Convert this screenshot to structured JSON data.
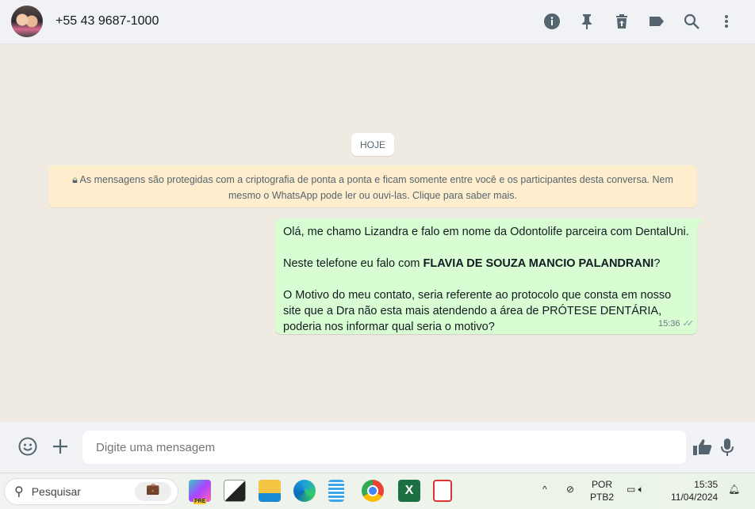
{
  "header": {
    "contact": "+55 43 9687-1000",
    "icons": [
      "info-icon",
      "pin-icon",
      "delete-icon",
      "label-icon",
      "search-icon",
      "menu-icon"
    ]
  },
  "chat": {
    "date_pill": "HOJE",
    "encryption_notice": "As mensagens são protegidas com a criptografia de ponta a ponta e ficam somente entre você e os participantes desta conversa. Nem mesmo o WhatsApp pode ler ou ouvi-las. Clique para saber mais.",
    "message": {
      "line1": "Olá, me chamo Lizandra e falo em nome da Odontolife parceira com DentalUni.",
      "line2_pre": "Neste telefone eu falo com ",
      "line2_bold": "FLAVIA DE SOUZA MANCIO PALANDRANI",
      "line2_post": "?",
      "line3": "O Motivo do meu contato, seria referente ao protocolo que consta em nosso site que a Dra não esta mais atendendo a área de PRÓTESE DENTÁRIA, poderia nos informar qual seria o motivo?",
      "time": "15:36",
      "status": "✓✓"
    }
  },
  "composer": {
    "placeholder": "Digite uma mensagem"
  },
  "taskbar": {
    "search": "Pesquisar",
    "lang1": "POR",
    "lang2": "PTB2",
    "time": "15:35",
    "date": "11/04/2024",
    "copilot_badge": "PRE"
  }
}
